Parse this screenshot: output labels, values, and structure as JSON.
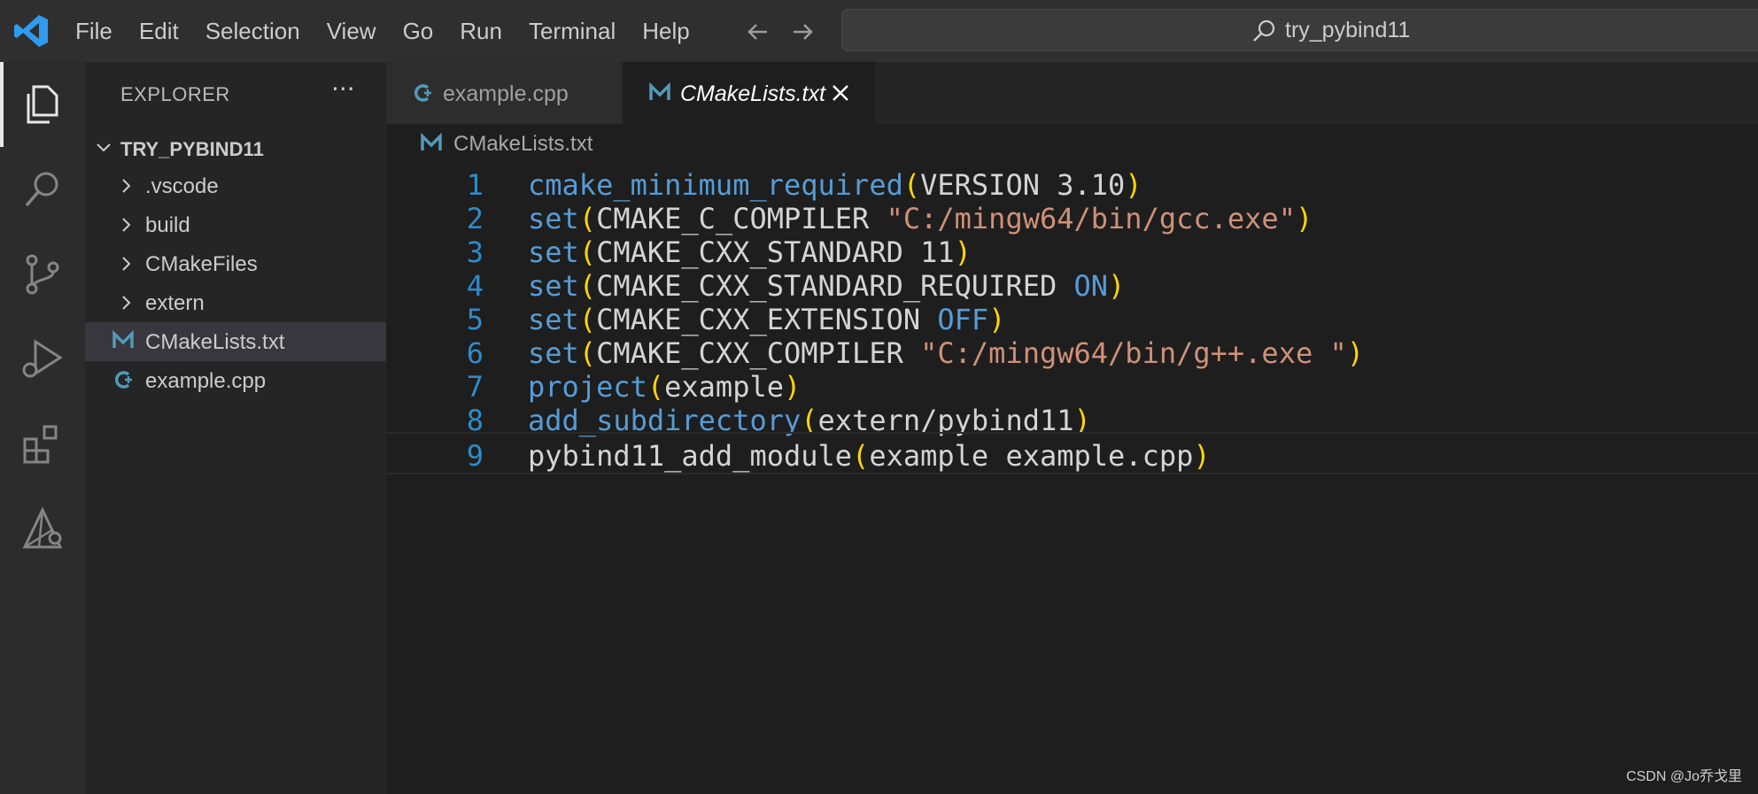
{
  "menu": {
    "items": [
      "File",
      "Edit",
      "Selection",
      "View",
      "Go",
      "Run",
      "Terminal",
      "Help"
    ]
  },
  "command_center": {
    "text": "try_pybind11"
  },
  "sidebar": {
    "title": "EXPLORER",
    "more": "···",
    "root_folder": "TRY_PYBIND11",
    "items": [
      {
        "label": ".vscode",
        "kind": "folder"
      },
      {
        "label": "build",
        "kind": "folder"
      },
      {
        "label": "CMakeFiles",
        "kind": "folder"
      },
      {
        "label": "extern",
        "kind": "folder"
      },
      {
        "label": "CMakeLists.txt",
        "kind": "cmake-file"
      },
      {
        "label": "example.cpp",
        "kind": "cpp-file"
      }
    ]
  },
  "tabs": [
    {
      "label": "example.cpp",
      "icon": "cpp-file-icon"
    },
    {
      "label": "CMakeLists.txt",
      "icon": "cmake-file-icon"
    }
  ],
  "breadcrumb": {
    "label": "CMakeLists.txt"
  },
  "editor": {
    "lines": [
      {
        "n": "1",
        "tokens": [
          [
            "fn",
            "cmake_minimum_required"
          ],
          [
            "pa",
            "("
          ],
          [
            "pl",
            "VERSION 3.10"
          ],
          [
            "pa",
            ")"
          ]
        ]
      },
      {
        "n": "2",
        "tokens": [
          [
            "fn",
            "set"
          ],
          [
            "pa",
            "("
          ],
          [
            "pl",
            "CMAKE_C_COMPILER "
          ],
          [
            "st",
            "\"C:/mingw64/bin/gcc.exe\""
          ],
          [
            "pa",
            ")"
          ]
        ]
      },
      {
        "n": "3",
        "tokens": [
          [
            "fn",
            "set"
          ],
          [
            "pa",
            "("
          ],
          [
            "pl",
            "CMAKE_CXX_STANDARD 11"
          ],
          [
            "pa",
            ")"
          ]
        ]
      },
      {
        "n": "4",
        "tokens": [
          [
            "fn",
            "set"
          ],
          [
            "pa",
            "("
          ],
          [
            "pl",
            "CMAKE_CXX_STANDARD_REQUIRED "
          ],
          [
            "kw",
            "ON"
          ],
          [
            "pa",
            ")"
          ]
        ]
      },
      {
        "n": "5",
        "tokens": [
          [
            "fn",
            "set"
          ],
          [
            "pa",
            "("
          ],
          [
            "pl",
            "CMAKE_CXX_EXTENSION "
          ],
          [
            "kw",
            "OFF"
          ],
          [
            "pa",
            ")"
          ]
        ]
      },
      {
        "n": "6",
        "tokens": [
          [
            "fn",
            "set"
          ],
          [
            "pa",
            "("
          ],
          [
            "pl",
            "CMAKE_CXX_COMPILER "
          ],
          [
            "st",
            "\"C:/mingw64/bin/g++.exe \""
          ],
          [
            "pa",
            ")"
          ]
        ]
      },
      {
        "n": "7",
        "tokens": [
          [
            "fn",
            "project"
          ],
          [
            "pa",
            "("
          ],
          [
            "pl",
            "example"
          ],
          [
            "pa",
            ")"
          ]
        ]
      },
      {
        "n": "8",
        "tokens": [
          [
            "fn",
            "add_subdirectory"
          ],
          [
            "pa",
            "("
          ],
          [
            "pl",
            "extern/pybind11"
          ],
          [
            "pa",
            ")"
          ]
        ]
      },
      {
        "n": "9",
        "tokens": [
          [
            "pl",
            "pybind11_add_module"
          ],
          [
            "pa",
            "("
          ],
          [
            "pl",
            "example example.cpp"
          ],
          [
            "pa",
            ")"
          ]
        ]
      }
    ]
  },
  "watermark": "CSDN @Jo乔戈里",
  "colors": {
    "accent": "#2f8bc9",
    "function": "#569cd6",
    "string": "#ce9178",
    "paren": "#ffd700"
  }
}
